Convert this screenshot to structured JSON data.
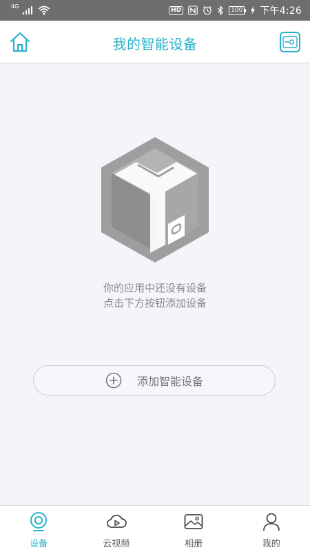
{
  "status_bar": {
    "network_type": "4G",
    "hd_label": "HD",
    "battery_level": "100",
    "time": "下午4:26"
  },
  "header": {
    "title": "我的智能设备",
    "home_icon": "home-icon",
    "scan_icon": "scan-device-icon"
  },
  "empty_state": {
    "illustration": "empty-box-illustration",
    "line1": "你的应用中还没有设备",
    "line2": "点击下方按钮添加设备"
  },
  "add_device": {
    "label": "添加智能设备",
    "icon": "plus-circle-icon"
  },
  "tabs": [
    {
      "label": "设备",
      "icon": "camera-device-icon",
      "active": true
    },
    {
      "label": "云视频",
      "icon": "cloud-video-icon",
      "active": false
    },
    {
      "label": "相册",
      "icon": "album-icon",
      "active": false
    },
    {
      "label": "我的",
      "icon": "person-icon",
      "active": false
    }
  ],
  "colors": {
    "accent": "#26b2c9",
    "status_bar": "#6e6e6e",
    "background": "#f4f5fa",
    "text_muted": "#8a8a8f",
    "illustration": "#9e9e9e"
  }
}
